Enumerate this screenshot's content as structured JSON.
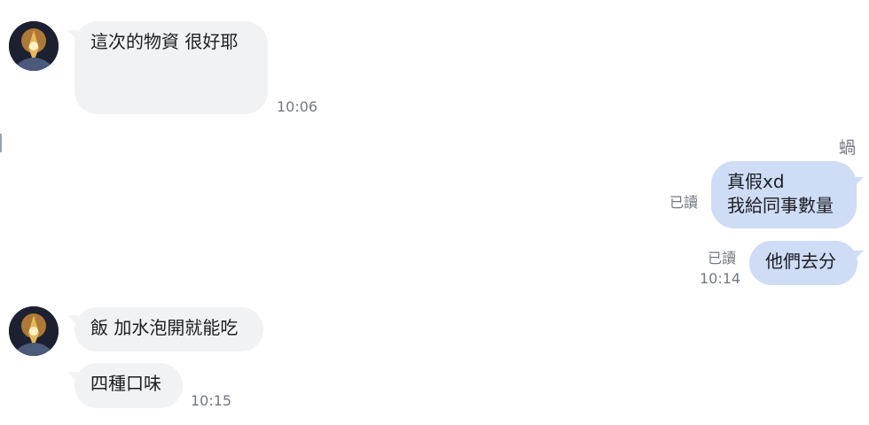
{
  "chat": {
    "group1": {
      "messages": [
        "這次的物資 很好耶"
      ],
      "time": "10:06"
    },
    "group2": {
      "sender": "蝸",
      "messages": [
        {
          "line1": "真假xd",
          "line2": "我給同事數量",
          "read": "已讀"
        },
        {
          "text": "他們去分",
          "read": "已讀",
          "time": "10:14"
        }
      ]
    },
    "group3": {
      "messages": [
        "飯 加水泡開就能吃",
        "四種口味"
      ],
      "time": "10:15"
    }
  },
  "colors": {
    "incoming_bubble": "#f1f2f4",
    "outgoing_bubble": "#cfdcf6",
    "meta_text": "#747881"
  },
  "icons": {
    "avatar": "avatar-image"
  }
}
